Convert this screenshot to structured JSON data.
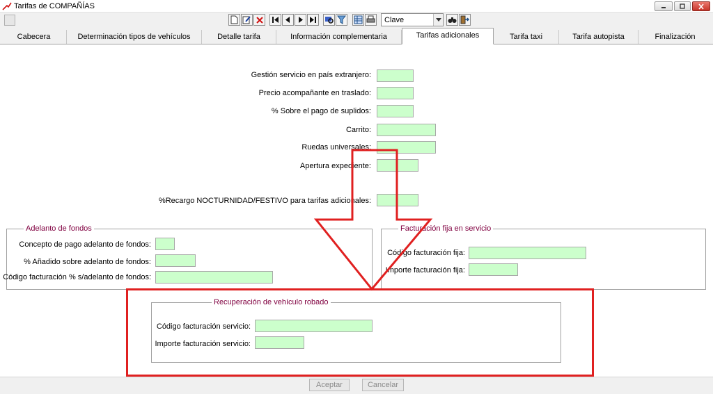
{
  "window": {
    "title": "Tarifas de COMPAÑÍAS"
  },
  "toolbar": {
    "combo_value": "Clave",
    "icons": [
      "new-icon",
      "edit-icon",
      "delete-icon",
      "first-icon",
      "prev-icon",
      "next-icon",
      "last-icon",
      "search-icon",
      "filter-icon",
      "grid-icon",
      "print-icon",
      "binoculars-icon",
      "exit-icon"
    ]
  },
  "tabs": [
    "Cabecera",
    "Determinación tipos de vehículos",
    "Detalle tarifa",
    "Información complementaria",
    "Tarifas adicionales",
    "Tarifa taxi",
    "Tarifa autopista",
    "Finalización"
  ],
  "active_tab": "Tarifas adicionales",
  "fields": {
    "gestion": "Gestión servicio en país extranjero:",
    "precio": "Precio acompañante en traslado:",
    "sobre": "% Sobre el pago de suplidos:",
    "carrito": "Carrito:",
    "ruedas": "Ruedas universales:",
    "apertura": "Apertura expediente:",
    "recargo": "%Recargo NOCTURNIDAD/FESTIVO para tarifas adicionales:"
  },
  "adelanto": {
    "title": "Adelanto de fondos",
    "concepto": "Concepto de pago adelanto de fondos:",
    "anadido": "% Añadido sobre adelanto de fondos:",
    "codigo": "Código facturación % s/adelanto de fondos:"
  },
  "facturacion": {
    "title": "Facturación fija en servicio",
    "codigo": "Código facturación fija:",
    "importe": "Importe facturación fija:"
  },
  "recuperacion": {
    "title": "Recuperación de vehículo robado",
    "codigo": "Código facturación servicio:",
    "importe": "Importe facturación servicio:"
  },
  "buttons": {
    "accept": "Aceptar",
    "cancel": "Cancelar"
  },
  "colors": {
    "field_bg": "#ccffcc",
    "group_title": "#800040",
    "annotation": "#e02020"
  }
}
